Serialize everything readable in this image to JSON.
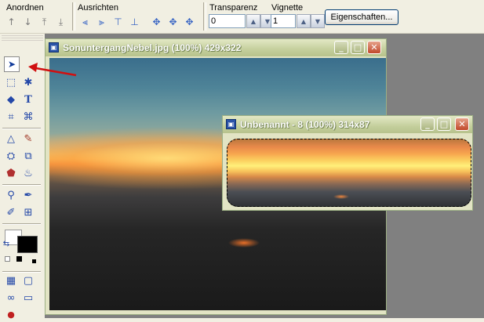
{
  "toolbar": {
    "anordnen_label": "Anordnen",
    "ausrichten_label": "Ausrichten",
    "transparenz_label": "Transparenz",
    "transparenz_value": "0",
    "vignette_label": "Vignette",
    "vignette_value": "1",
    "eigenschaften_label": "Eigenschaften..."
  },
  "windows": {
    "image1": {
      "title": "SonuntergangNebel.jpg (100%) 429x322"
    },
    "image2": {
      "title": "Unbenannt - 8 (100%) 314x87"
    }
  },
  "annotation": {
    "arrow_color": "#d01010"
  },
  "colors": {
    "foreground": "#ffffff",
    "background": "#000000"
  }
}
